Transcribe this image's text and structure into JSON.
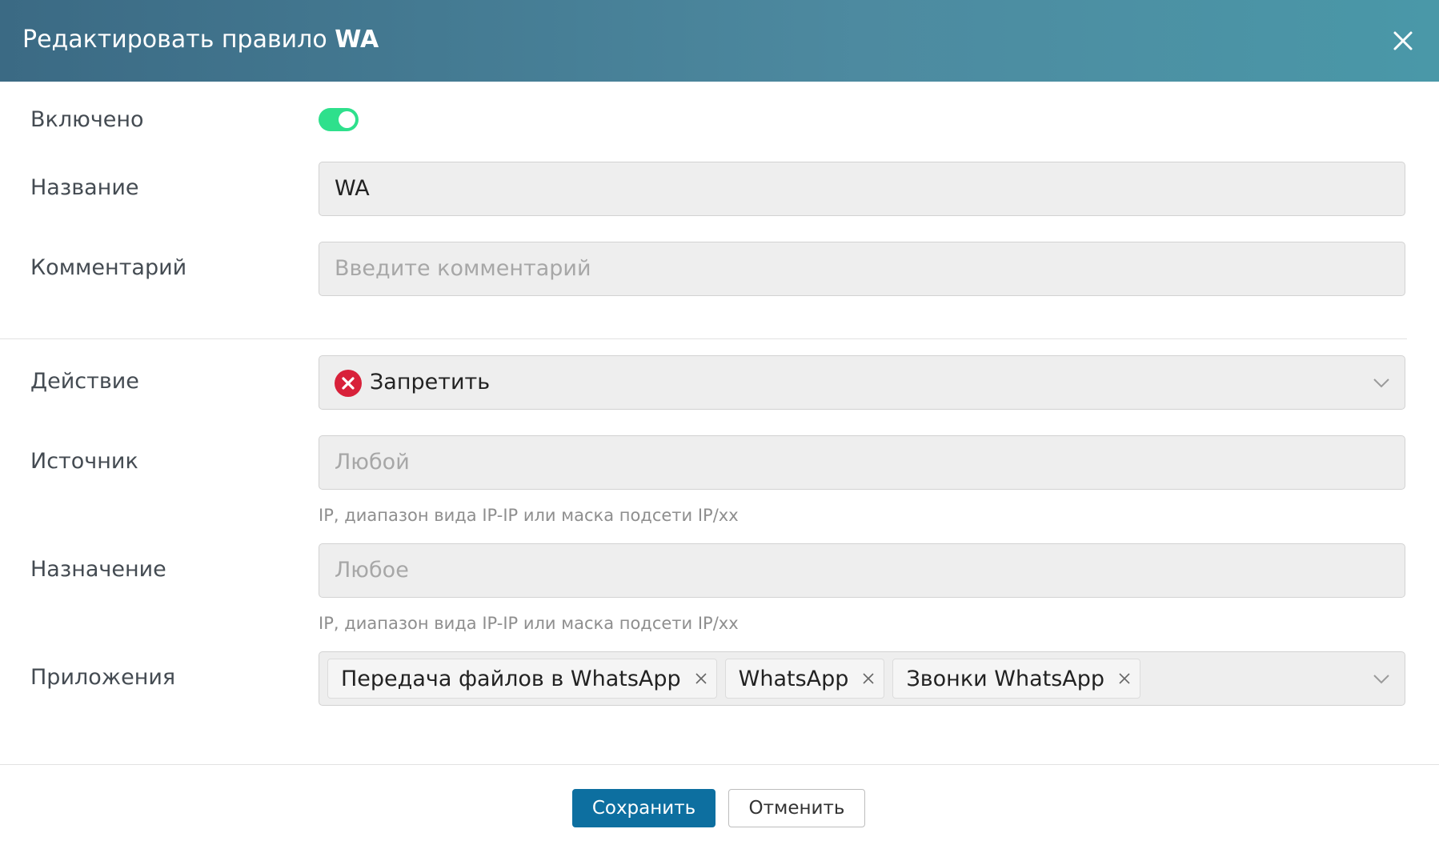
{
  "dialog": {
    "title_prefix": "Редактировать правило",
    "title_name": "WA",
    "close_icon": "close-icon"
  },
  "form": {
    "enabled": {
      "label": "Включено",
      "value": true
    },
    "name": {
      "label": "Название",
      "value": "WA"
    },
    "comment": {
      "label": "Комментарий",
      "placeholder": "Введите комментарий",
      "value": ""
    },
    "action": {
      "label": "Действие",
      "value": "Запретить",
      "icon": "deny-icon",
      "icon_color": "#d8213a"
    },
    "source": {
      "label": "Источник",
      "placeholder": "Любой",
      "hint": "IP, диапазон вида IP-IP или маска подсети IP/xx"
    },
    "destination": {
      "label": "Назначение",
      "placeholder": "Любое",
      "hint": "IP, диапазон вида IP-IP или маска подсети IP/xx"
    },
    "applications": {
      "label": "Приложения",
      "tags": [
        "Передача файлов в WhatsApp",
        "WhatsApp",
        "Звонки WhatsApp"
      ]
    }
  },
  "footer": {
    "save_label": "Сохранить",
    "cancel_label": "Отменить"
  },
  "colors": {
    "header_gradient_start": "#3b6a84",
    "header_gradient_end": "#4a98a8",
    "toggle_on": "#2ee08c",
    "primary_button": "#0d6fa0"
  }
}
